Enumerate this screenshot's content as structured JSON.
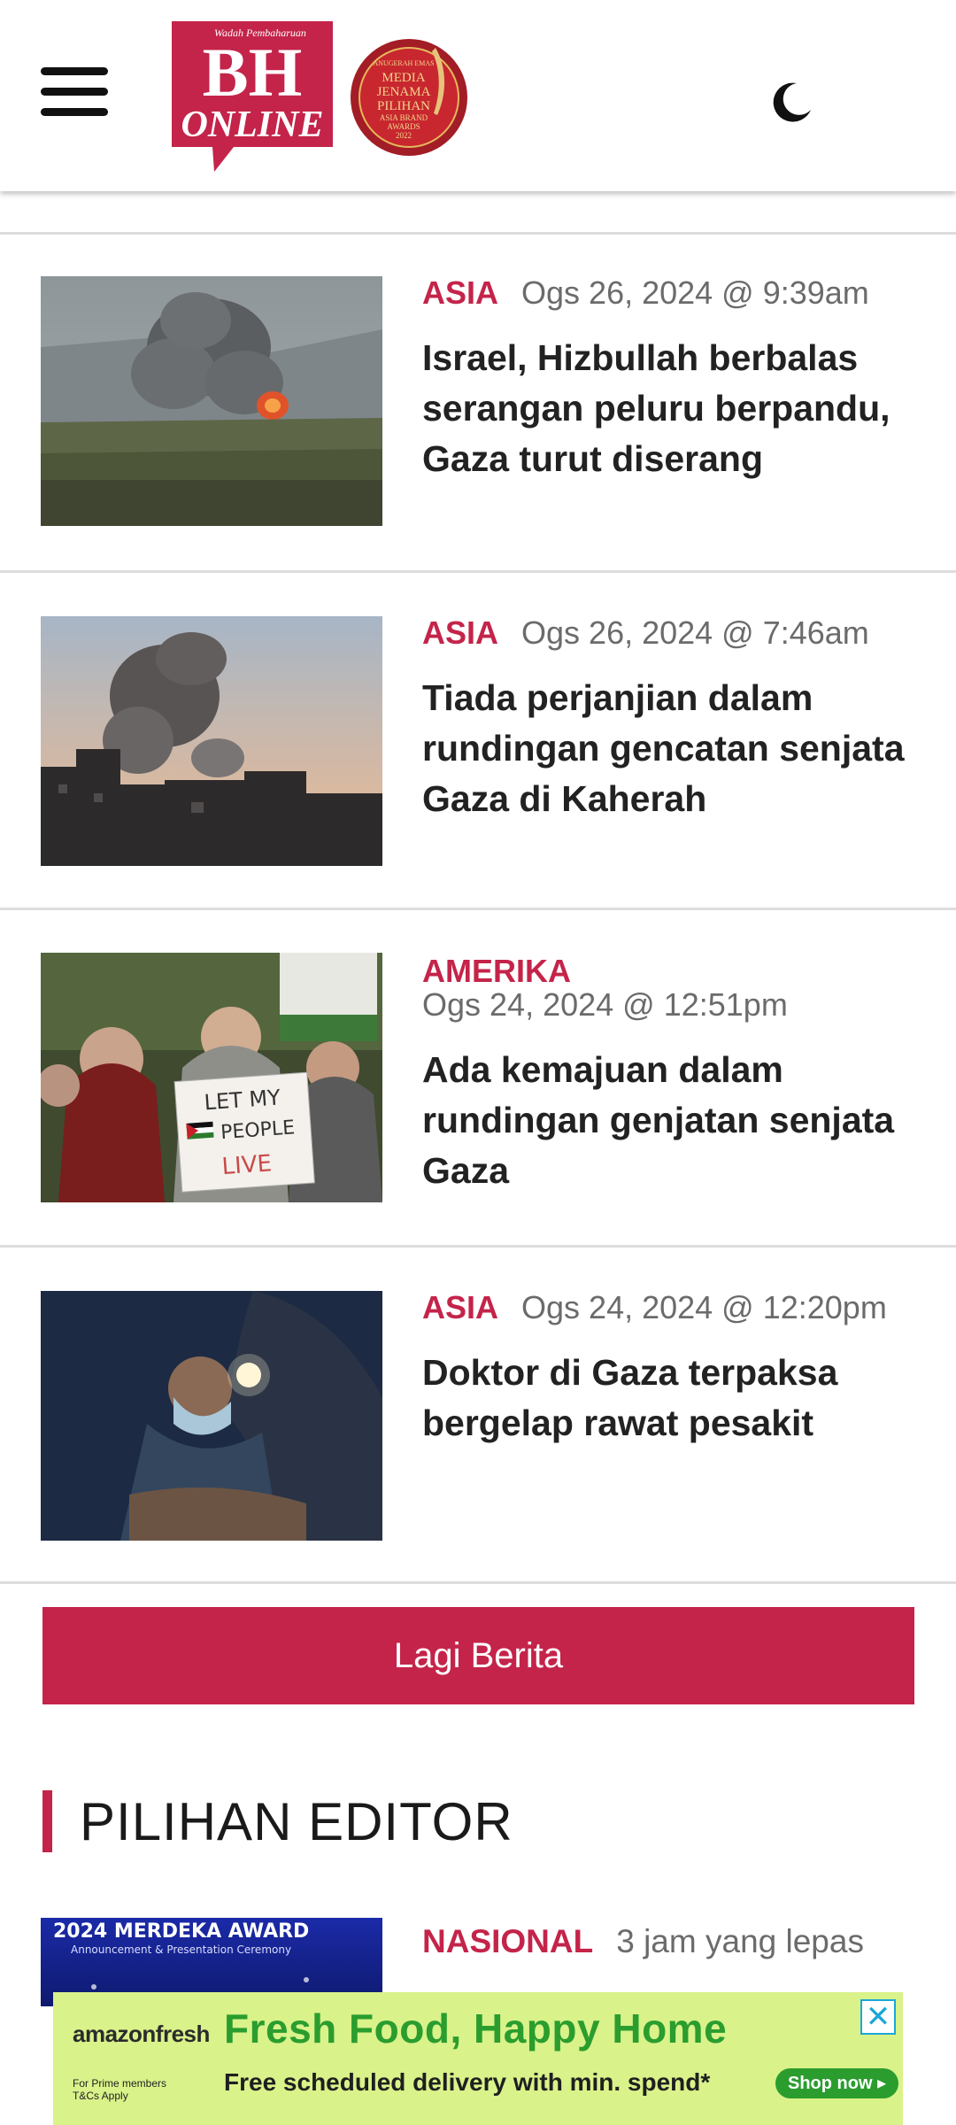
{
  "header": {
    "logo_tagline": "Wadah Pembaharuan",
    "logo_line1": "BH",
    "logo_line2": "ONLINE",
    "award_lines": [
      "ANUGERAH EMAS",
      "MEDIA",
      "JENAMA",
      "PILIHAN",
      "ASIA BRAND",
      "AWARDS",
      "2022"
    ],
    "menu_icon": "hamburger-menu-icon",
    "theme_icon": "moon-icon"
  },
  "articles": [
    {
      "category": "ASIA",
      "date": "Ogs 26, 2024 @ 9:39am",
      "title": "Israel, Hizbullah berbalas serangan peluru berpandu, Gaza turut diserang"
    },
    {
      "category": "ASIA",
      "date": "Ogs 26, 2024 @ 7:46am",
      "title": "Tiada perjanjian dalam rundingan gencatan senjata Gaza di Kaherah"
    },
    {
      "category": "AMERIKA",
      "date": "Ogs 24, 2024 @ 12:51pm",
      "title": "Ada kemajuan dalam rundingan genjatan senjata Gaza",
      "image_sign": [
        "LET MY",
        "PEOPLE",
        "LIVE"
      ]
    },
    {
      "category": "ASIA",
      "date": "Ogs 24, 2024 @ 12:20pm",
      "title": "Doktor di Gaza terpaksa bergelap rawat pesakit"
    }
  ],
  "more_button": "Lagi Berita",
  "editor_section": {
    "title": "PILIHAN EDITOR",
    "item": {
      "category": "NASIONAL",
      "date": "3 jam yang lepas",
      "thumb_text": "2024 MERDEKA AWARD",
      "thumb_sub": "Announcement & Presentation Ceremony"
    }
  },
  "ad": {
    "brand": "amazonfresh",
    "brand_sub": "For Prime members T&Cs Apply",
    "headline": "Fresh Food, Happy Home",
    "sub": "Free scheduled delivery with min. spend*",
    "shop": "Shop now ▸",
    "close": "✕"
  },
  "colors": {
    "accent": "#c4244a",
    "ad_bg": "#d9f28a",
    "ad_green": "#2a9d2e"
  }
}
